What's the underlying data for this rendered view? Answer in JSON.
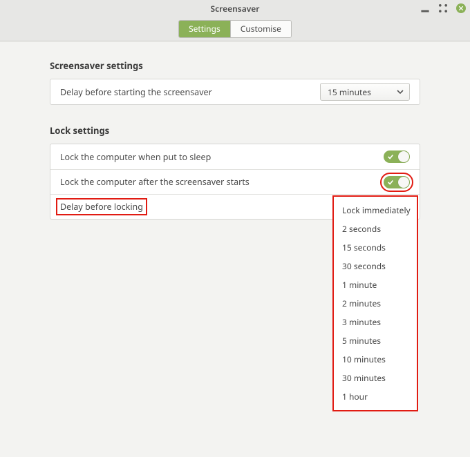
{
  "window": {
    "title": "Screensaver"
  },
  "tabs": {
    "settings": "Settings",
    "customise": "Customise"
  },
  "screensaver": {
    "section_title": "Screensaver settings",
    "delay_label": "Delay before starting the screensaver",
    "delay_value": "15 minutes"
  },
  "lock": {
    "section_title": "Lock settings",
    "sleep_label": "Lock the computer when put to sleep",
    "sleep_on": true,
    "after_ss_label": "Lock the computer after the screensaver starts",
    "after_ss_on": true,
    "delay_label": "Delay before locking",
    "delay_options": [
      "Lock immediately",
      "2 seconds",
      "15 seconds",
      "30 seconds",
      "1 minute",
      "2 minutes",
      "3 minutes",
      "5 minutes",
      "10 minutes",
      "30 minutes",
      "1 hour"
    ]
  }
}
